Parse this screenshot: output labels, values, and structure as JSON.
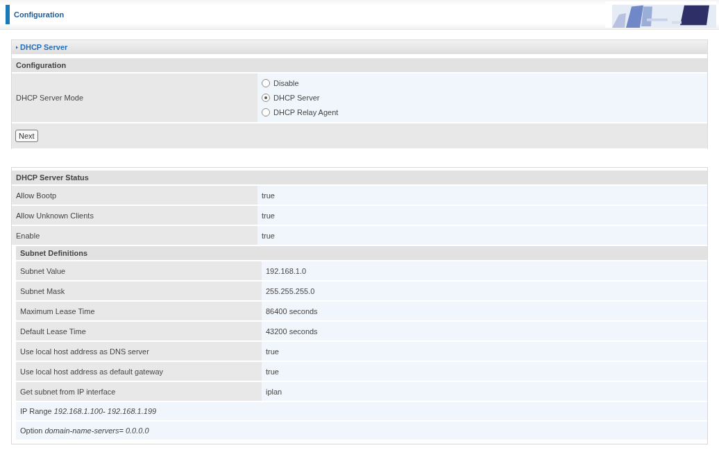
{
  "header": {
    "title": "Configuration"
  },
  "section": {
    "title": "DHCP Server"
  },
  "config": {
    "title": "Configuration",
    "mode_label": "DHCP Server Mode",
    "options": [
      {
        "label": "Disable",
        "selected": false
      },
      {
        "label": "DHCP Server",
        "selected": true
      },
      {
        "label": "DHCP Relay Agent",
        "selected": false
      }
    ],
    "button": "Next"
  },
  "status": {
    "title": "DHCP Server Status",
    "rows": [
      {
        "label": "Allow Bootp",
        "value": "true"
      },
      {
        "label": "Allow Unknown Clients",
        "value": "true"
      },
      {
        "label": "Enable",
        "value": "true"
      }
    ],
    "subnet": {
      "title": "Subnet Definitions",
      "rows": [
        {
          "label": "Subnet Value",
          "value": "192.168.1.0"
        },
        {
          "label": "Subnet Mask",
          "value": "255.255.255.0"
        },
        {
          "label": "Maximum Lease Time",
          "value": "86400 seconds"
        },
        {
          "label": "Default Lease Time",
          "value": "43200 seconds"
        },
        {
          "label": "Use local host address as DNS server",
          "value": "true"
        },
        {
          "label": "Use local host address as default gateway",
          "value": "true"
        },
        {
          "label": "Get subnet from IP interface",
          "value": "iplan"
        }
      ],
      "notes": [
        "IP Range *192.168.1.100- 192.168.1.199*",
        "Option *domain-name-servers= 0.0.0.0*"
      ]
    }
  }
}
